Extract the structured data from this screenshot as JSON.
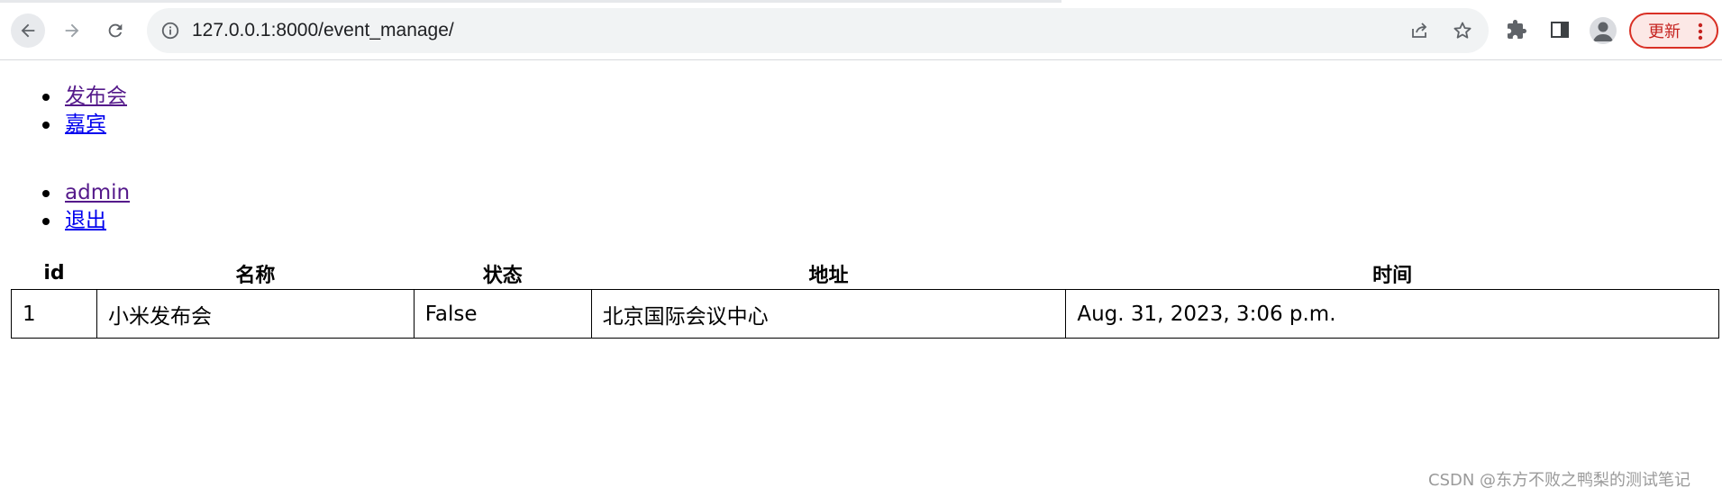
{
  "browser": {
    "url": "127.0.0.1:8000/event_manage/",
    "update_label": "更新",
    "icons": [
      "back-icon",
      "forward-icon",
      "reload-icon",
      "site-info-icon",
      "share-icon",
      "bookmark-star-icon",
      "extensions-icon",
      "side-panel-icon",
      "profile-icon",
      "more-menu-icon"
    ],
    "accent": "#d93025"
  },
  "nav": {
    "primary": [
      {
        "label": "发布会",
        "visited": true
      },
      {
        "label": "嘉宾",
        "visited": false
      }
    ],
    "user": [
      {
        "label": "admin",
        "visited": true
      },
      {
        "label": "退出",
        "visited": false
      }
    ]
  },
  "table": {
    "columns": [
      "id",
      "名称",
      "状态",
      "地址",
      "时间"
    ],
    "rows": [
      [
        "1",
        "小米发布会",
        "False",
        "北京国际会议中心",
        "Aug. 31, 2023, 3:06 p.m."
      ]
    ]
  },
  "watermark": "CSDN @东方不败之鸭梨的测试笔记"
}
